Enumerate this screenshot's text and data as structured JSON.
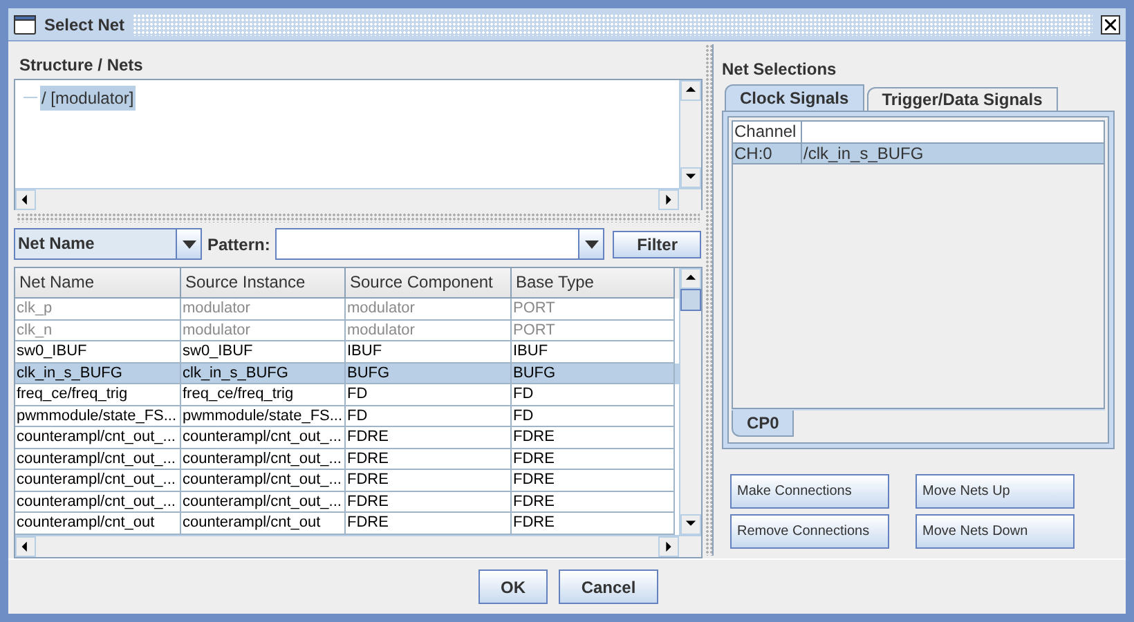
{
  "window": {
    "title": "Select Net"
  },
  "structure": {
    "title": "Structure / Nets",
    "tree": [
      {
        "label": "/ [modulator]",
        "selected": true
      }
    ]
  },
  "filter": {
    "field": "Net Name",
    "pattern_label": "Pattern:",
    "button": "Filter"
  },
  "table": {
    "columns": [
      "Net Name",
      "Source Instance",
      "Source Component",
      "Base Type"
    ],
    "rows": [
      {
        "cells": [
          "clk_p",
          "modulator",
          "modulator",
          "PORT"
        ],
        "disabled": true,
        "selected": false
      },
      {
        "cells": [
          "clk_n",
          "modulator",
          "modulator",
          "PORT"
        ],
        "disabled": true,
        "selected": false
      },
      {
        "cells": [
          "sw0_IBUF",
          "sw0_IBUF",
          "IBUF",
          "IBUF"
        ],
        "disabled": false,
        "selected": false
      },
      {
        "cells": [
          "clk_in_s_BUFG",
          "clk_in_s_BUFG",
          "BUFG",
          "BUFG"
        ],
        "disabled": false,
        "selected": true
      },
      {
        "cells": [
          "freq_ce/freq_trig",
          "freq_ce/freq_trig",
          "FD",
          "FD"
        ],
        "disabled": false,
        "selected": false
      },
      {
        "cells": [
          "pwmmodule/state_FS...",
          "pwmmodule/state_FS...",
          "FD",
          "FD"
        ],
        "disabled": false,
        "selected": false
      },
      {
        "cells": [
          "counterampl/cnt_out_...",
          "counterampl/cnt_out_...",
          "FDRE",
          "FDRE"
        ],
        "disabled": false,
        "selected": false
      },
      {
        "cells": [
          "counterampl/cnt_out_...",
          "counterampl/cnt_out_...",
          "FDRE",
          "FDRE"
        ],
        "disabled": false,
        "selected": false
      },
      {
        "cells": [
          "counterampl/cnt_out_...",
          "counterampl/cnt_out_...",
          "FDRE",
          "FDRE"
        ],
        "disabled": false,
        "selected": false
      },
      {
        "cells": [
          "counterampl/cnt_out_...",
          "counterampl/cnt_out_...",
          "FDRE",
          "FDRE"
        ],
        "disabled": false,
        "selected": false
      },
      {
        "cells": [
          "counterampl/cnt_out",
          "counterampl/cnt_out",
          "FDRE",
          "FDRE"
        ],
        "disabled": false,
        "selected": false
      }
    ]
  },
  "net_selections": {
    "title": "Net Selections",
    "tabs": [
      {
        "label": "Clock Signals",
        "selected": true
      },
      {
        "label": "Trigger/Data Signals",
        "selected": false
      }
    ],
    "table": {
      "columns": [
        "Channel"
      ],
      "rows": [
        {
          "cells": [
            "CH:0",
            "/clk_in_s_BUFG"
          ],
          "selected": true
        }
      ]
    },
    "bottom_tabs": [
      {
        "label": "CP0",
        "selected": true
      }
    ],
    "buttons": [
      "Make Connections",
      "Move Nets Up",
      "Remove Connections",
      "Move Nets Down"
    ]
  },
  "buttons": [
    "OK",
    "Cancel"
  ]
}
